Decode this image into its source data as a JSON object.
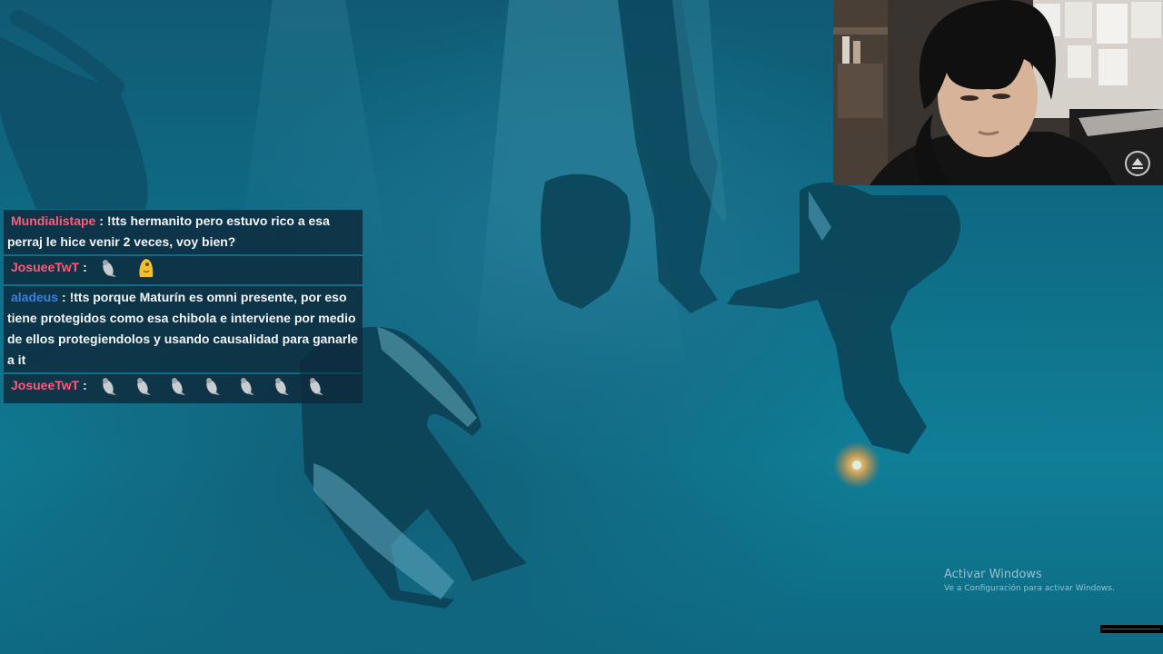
{
  "stream": {
    "scene_description_icon": "underwater-scene"
  },
  "chat": {
    "messages": [
      {
        "user": "Mundialistape",
        "user_color": "#ff5a7a",
        "separator": " : ",
        "text": "!tts hermanito pero estuvo rico a esa perraj le hice venir 2 veces, voy bien?",
        "emotes": []
      },
      {
        "user": "JosueeTwT",
        "user_color": "#ff5a7a",
        "separator": " : ",
        "text": "",
        "emotes": [
          "penguin-emote",
          "yellow-blob-emote"
        ]
      },
      {
        "user": "aladeus",
        "user_color": "#3d7fe0",
        "separator": " : ",
        "text": "!tts porque Maturín es omni presente, por eso tiene protegidos como esa chibola e interviene por medio de ellos protegiendolos y usando causalidad para ganarle a it",
        "emotes": []
      },
      {
        "user": "JosueeTwT",
        "user_color": "#ff5a7a",
        "separator": " : ",
        "text": "",
        "emotes": [
          "penguin-emote",
          "penguin-emote",
          "penguin-emote",
          "penguin-emote",
          "penguin-emote",
          "penguin-emote",
          "penguin-emote"
        ]
      }
    ]
  },
  "webcam": {
    "control_icon": "eject-icon"
  },
  "windows_watermark": {
    "title": "Activar Windows",
    "subtitle": "Ve a Configuración para activar Windows."
  },
  "colors": {
    "chat_bg": "#0e283a",
    "water": "#0e6c86"
  }
}
